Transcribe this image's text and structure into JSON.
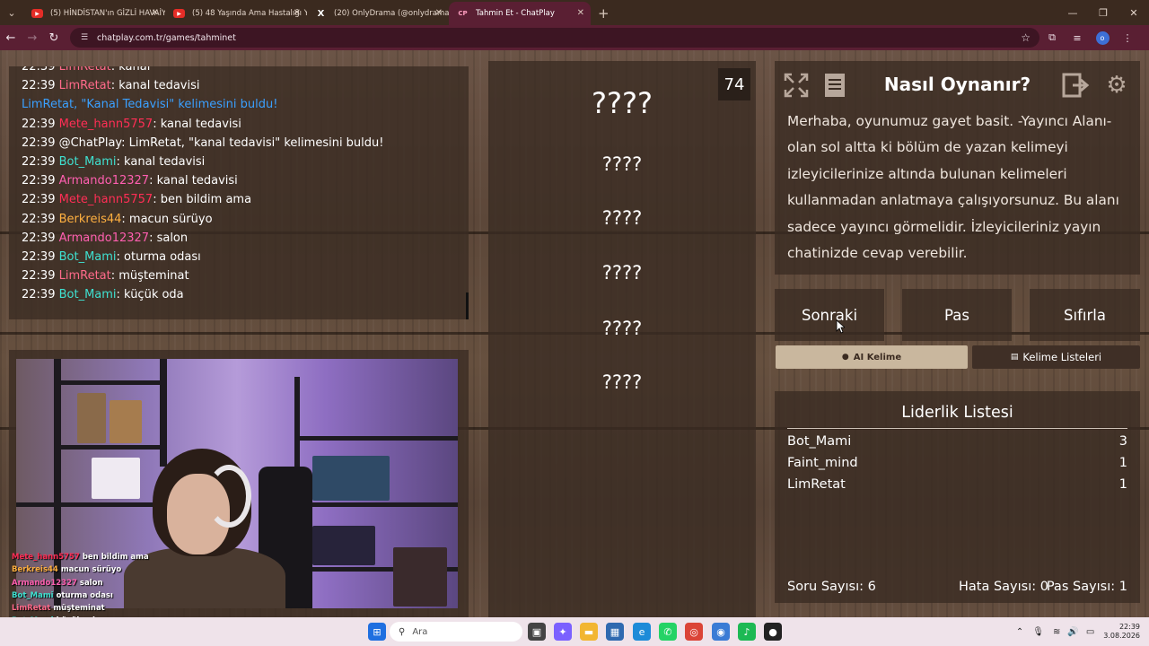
{
  "browser": {
    "tabs": [
      {
        "title": "(5) HİNDİSTAN'ın GİZLİ HAVAİY",
        "icon": "youtube-icon"
      },
      {
        "title": "(5) 48 Yaşında Ama Hastalığı Yü",
        "icon": "youtube-icon"
      },
      {
        "title": "(20) OnlyDrama (@onlydrama)",
        "icon": "x-icon"
      },
      {
        "title": "Tahmin Et - ChatPlay",
        "icon": "chatplay-icon"
      }
    ],
    "url": "chatplay.com.tr/games/tahminet",
    "profile_initial": "o"
  },
  "chat": {
    "lines": [
      {
        "time": "22:39",
        "user": "LimRetat",
        "user_color": "#ff6a8a",
        "text": ": kanal"
      },
      {
        "time": "22:39",
        "user": "LimRetat",
        "user_color": "#ff6a8a",
        "text": ": kanal tedavisi"
      },
      {
        "time": "",
        "user": "",
        "user_color": "#3aa0ff",
        "text": "LimRetat, \"Kanal Tedavisi\" kelimesini buldu!"
      },
      {
        "time": "22:39",
        "user": "Mete_hann5757",
        "user_color": "#ff2e55",
        "text": ": kanal tedavisi"
      },
      {
        "time": "22:39",
        "user": "",
        "user_color": "#ffffff",
        "text": "@ChatPlay: LimRetat, \"kanal tedavisi\" kelimesini buldu!"
      },
      {
        "time": "22:39",
        "user": "Bot_Mami",
        "user_color": "#3fe0d0",
        "text": ": kanal tedavisi"
      },
      {
        "time": "22:39",
        "user": "Armando12327",
        "user_color": "#ff5fb0",
        "text": ": kanal tedavisi"
      },
      {
        "time": "22:39",
        "user": "Mete_hann5757",
        "user_color": "#ff2e55",
        "text": ": ben bildim ama"
      },
      {
        "time": "22:39",
        "user": "Berkreis44",
        "user_color": "#ffb040",
        "text": ": macun sürüyo"
      },
      {
        "time": "22:39",
        "user": "Armando12327",
        "user_color": "#ff5fb0",
        "text": ": salon"
      },
      {
        "time": "22:39",
        "user": "Bot_Mami",
        "user_color": "#3fe0d0",
        "text": ": oturma odası"
      },
      {
        "time": "22:39",
        "user": "LimRetat",
        "user_color": "#ff6a8a",
        "text": ": müşteminat"
      },
      {
        "time": "22:39",
        "user": "Bot_Mami",
        "user_color": "#3fe0d0",
        "text": ": küçük oda"
      }
    ]
  },
  "stream_chat": [
    {
      "user": "Mete_hann5757",
      "color": "#ff2e55",
      "text": "ben bildim ama"
    },
    {
      "user": "Berkreis44",
      "color": "#ffb040",
      "text": "macun sürüyo"
    },
    {
      "user": "Armando12327",
      "color": "#ff5fb0",
      "text": "salon"
    },
    {
      "user": "Bot_Mami",
      "color": "#3fe0d0",
      "text": "oturma odası"
    },
    {
      "user": "LimRetat",
      "color": "#ff6a8a",
      "text": "müşteminat"
    },
    {
      "user": "Bot_Mami",
      "color": "#3fe0d0",
      "text": "küçük oda"
    }
  ],
  "game": {
    "timer": "74",
    "words": [
      "????",
      "????",
      "????",
      "????",
      "????",
      "????"
    ]
  },
  "howto": {
    "title": "Nasıl Oynanır?",
    "body": "Merhaba, oyunumuz gayet basit. -Yayıncı Alanı- olan sol altta ki bölüm de yazan kelimeyi izleyicilerinize altında bulunan kelimeleri kullanmadan anlatmaya çalışıyorsunuz. Bu alanı sadece yayıncı görmelidir. İzleyicileriniz yayın chatinizde cevap verebilir."
  },
  "actions": {
    "next": "Sonraki",
    "pass": "Pas",
    "reset": "Sıfırla",
    "ai_word": "AI Kelime",
    "word_lists": "Kelime Listeleri"
  },
  "leaderboard": {
    "title": "Liderlik Listesi",
    "rows": [
      {
        "name": "Bot_Mami",
        "score": "3"
      },
      {
        "name": "Faint_mind",
        "score": "1"
      },
      {
        "name": "LimRetat",
        "score": "1"
      }
    ],
    "question_count_label": "Soru Sayısı: 6",
    "error_count_label": "Hata Sayısı: 0",
    "pass_count_label": "Pas Sayısı: 1"
  },
  "taskbar": {
    "search_placeholder": "Ara",
    "time": "22:39",
    "date": "3.08.2026"
  },
  "colors": {
    "active_tab": "#5a1f33",
    "ai_button": "#c9b79e",
    "panel": "#3a2c23"
  }
}
